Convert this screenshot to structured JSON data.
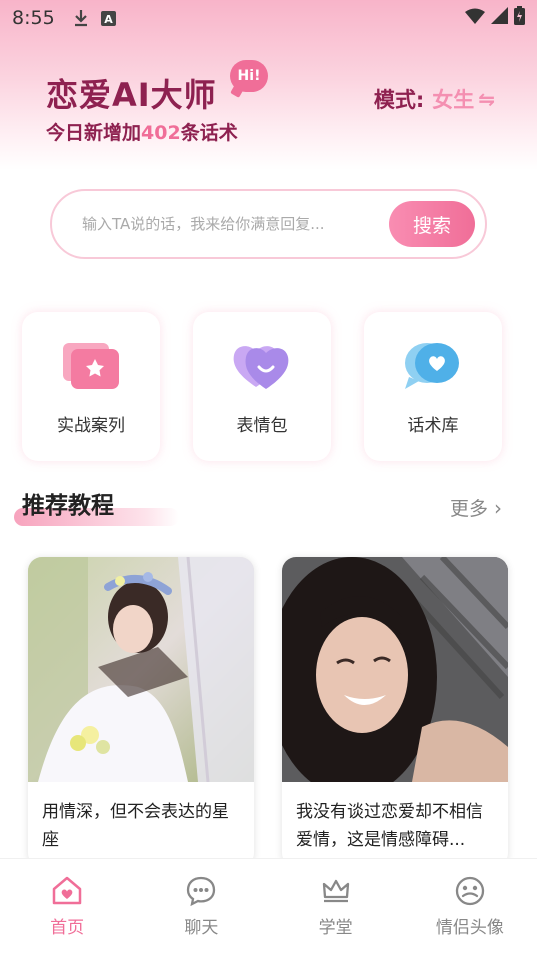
{
  "status_bar": {
    "time": "8:55"
  },
  "header": {
    "title": "恋爱AI大师",
    "badge": "Hi!",
    "subtitle_prefix": "今日新增加",
    "subtitle_count": "402",
    "subtitle_suffix": "条话术",
    "mode_label": "模式:",
    "mode_value": "女生",
    "mode_swap_icon": "⇋"
  },
  "search": {
    "placeholder": "输入TA说的话，我来给你满意回复...",
    "button_label": "搜索"
  },
  "features": [
    {
      "label": "实战案列",
      "icon": "folder-star-icon"
    },
    {
      "label": "表情包",
      "icon": "heart-smile-icon"
    },
    {
      "label": "话术库",
      "icon": "chat-heart-icon"
    }
  ],
  "section": {
    "title": "推荐教程",
    "more_label": "更多",
    "more_icon": "›"
  },
  "cards": [
    {
      "title": "用情深，但不会表达的星座",
      "image": "girl-in-hammock-photo"
    },
    {
      "title": "我没有谈过恋爱却不相信爱情，这是情感障碍...",
      "image": "smiling-girl-photo"
    }
  ],
  "tabs": [
    {
      "label": "首页",
      "icon": "home-heart-icon",
      "active": true
    },
    {
      "label": "聊天",
      "icon": "chat-bubble-icon",
      "active": false
    },
    {
      "label": "学堂",
      "icon": "crown-icon",
      "active": false
    },
    {
      "label": "情侣头像",
      "icon": "couple-face-icon",
      "active": false
    }
  ],
  "colors": {
    "accent": "#f06e98",
    "brand_dark": "#8e2150",
    "accent_light": "#f8b4c9"
  }
}
